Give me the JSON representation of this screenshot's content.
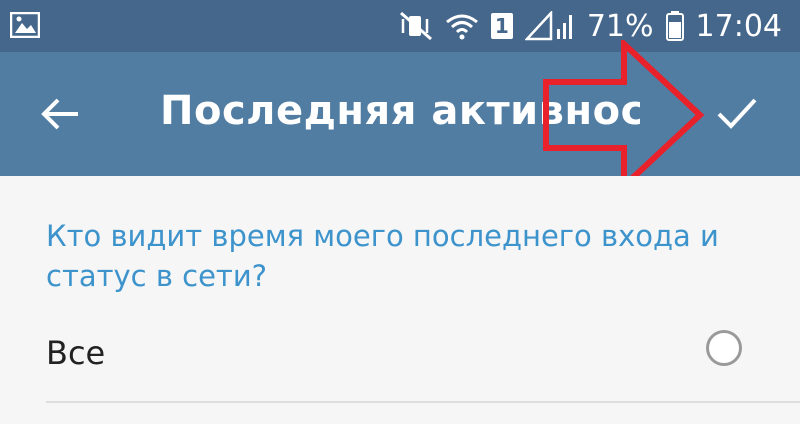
{
  "status_bar": {
    "battery_percent": "71%",
    "time": "17:04",
    "sim_slot": "1",
    "icons": [
      "gallery-icon",
      "mute-vibrate-icon",
      "wifi-icon",
      "signal-icon",
      "battery-icon"
    ]
  },
  "app_bar": {
    "title": "Последняя активнос...",
    "back_icon": "arrow-left-icon",
    "confirm_icon": "checkmark-icon"
  },
  "annotation": {
    "arrow_color": "#e8212a"
  },
  "colors": {
    "status_bar": "#45678c",
    "app_bar": "#527da3",
    "accent": "#3d93cc"
  },
  "privacy": {
    "question": "Кто видит время моего последнего входа и статус в сети?",
    "options": [
      {
        "label": "Все",
        "selected": false
      }
    ]
  }
}
